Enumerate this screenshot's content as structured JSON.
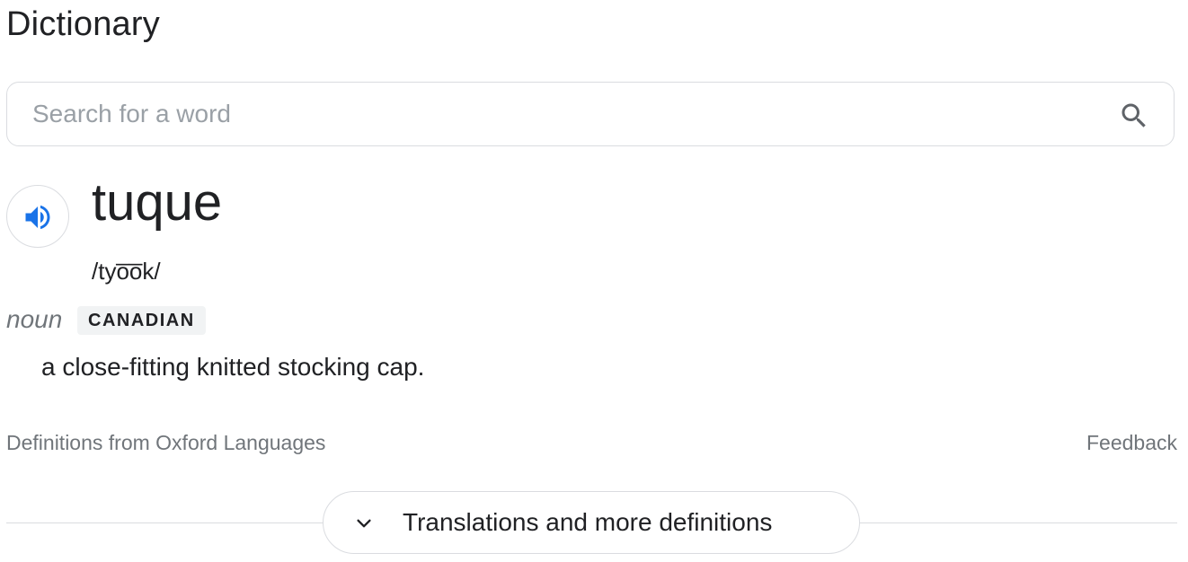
{
  "header": {
    "title": "Dictionary"
  },
  "search": {
    "placeholder": "Search for a word",
    "value": "",
    "icon": "search-icon"
  },
  "entry": {
    "speaker_icon": "speaker-icon",
    "word": "tuque",
    "pronunciation": "/tyo̅o̅k/",
    "part_of_speech": "noun",
    "region_badge": "CANADIAN",
    "definition": "a close-fitting knitted stocking cap."
  },
  "footer": {
    "source": "Definitions from Oxford Languages",
    "feedback": "Feedback"
  },
  "more": {
    "label": "Translations and more definitions",
    "icon": "chevron-down-icon"
  },
  "colors": {
    "text": "#202124",
    "muted": "#70757a",
    "border": "#dadce0",
    "accent": "#1a73e8",
    "badge_bg": "#f1f3f4"
  }
}
